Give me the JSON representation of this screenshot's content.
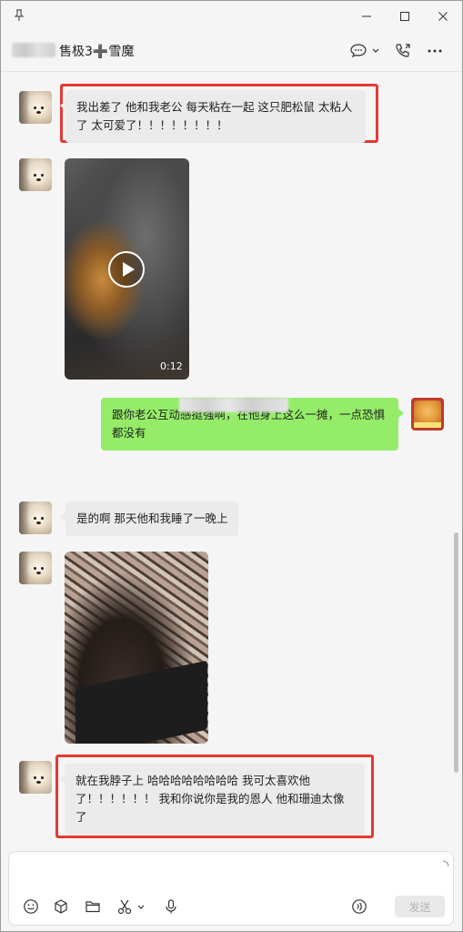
{
  "header": {
    "title": "售极3➕雪魔"
  },
  "messages": [
    {
      "side": "left",
      "type": "text",
      "text": "我出差了 他和我老公 每天粘在一起 这只肥松鼠 太粘人了 太可爱了！！！！！！！！",
      "highlighted": true
    },
    {
      "side": "left",
      "type": "video",
      "duration": "0:12"
    },
    {
      "side": "right",
      "type": "text",
      "text": "跟你老公互动感挺强啊，在他身上这么一摊，一点恐惧都没有"
    },
    {
      "side": "left",
      "type": "text",
      "text": "是的啊 那天他和我睡了一晚上"
    },
    {
      "side": "left",
      "type": "image"
    },
    {
      "side": "left",
      "type": "text",
      "text": "就在我脖子上 哈哈哈哈哈哈哈哈 我可太喜欢他了！！！！！！ 我和你说你是我的恩人 他和珊迪太像了",
      "highlighted": true
    }
  ],
  "input": {
    "send_label": "发送"
  },
  "colors": {
    "highlight": "#e53935",
    "my_bubble": "#95ec69",
    "their_bubble": "#ebebeb"
  },
  "icons": {
    "titlebar": [
      "pin-icon",
      "minimize-icon",
      "maximize-icon",
      "close-icon"
    ],
    "header": [
      "chat-bubble-icon",
      "chevron-down-icon",
      "phone-icon",
      "more-icon"
    ],
    "toolbar": [
      "emoji-icon",
      "cube-icon",
      "folder-icon",
      "scissors-icon",
      "chevron-down-icon",
      "microphone-icon",
      "voice-call-icon"
    ]
  }
}
